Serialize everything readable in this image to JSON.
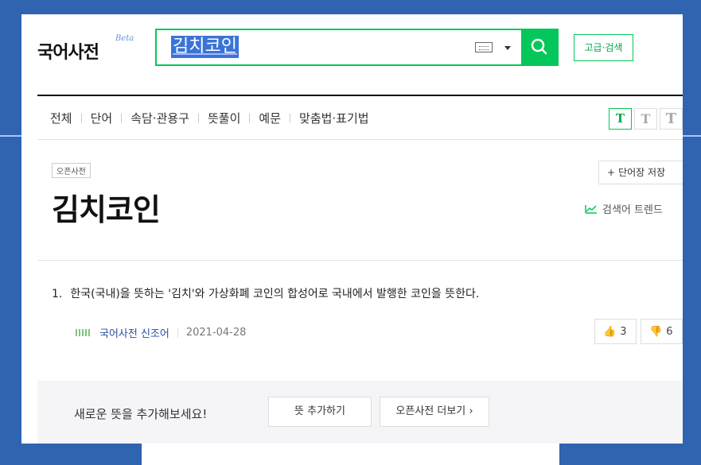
{
  "header": {
    "logo": "국어사전",
    "beta": "Beta",
    "search_value": "김치코인",
    "advanced_search": "고급·검색"
  },
  "tabs": [
    "전체",
    "단어",
    "속담·관용구",
    "뜻풀이",
    "예문",
    "맞춤법·표기법"
  ],
  "font_size_options": [
    "T",
    "T",
    "T"
  ],
  "entry": {
    "tag": "오픈사전",
    "title": "김치코인",
    "save_label": "단어장 저장",
    "trend_label": "검색어 트렌드",
    "definition_number": "1.",
    "definition": "한국(국내)을 뜻하는 '김치'와 가상화폐 코인의 합성어로 국내에서 발행한 코인을 뜻한다.",
    "source": "국어사전 신조어",
    "date": "2021-04-28",
    "upvotes": "3",
    "downvotes": "6"
  },
  "footer": {
    "prompt": "새로운 뜻을 추가해보세요!",
    "add_button": "뜻 추가하기",
    "more_button": "오픈사전 더보기 ›"
  },
  "colors": {
    "accent": "#03c75a",
    "background": "#3063b0",
    "selection": "#3a74d6"
  }
}
